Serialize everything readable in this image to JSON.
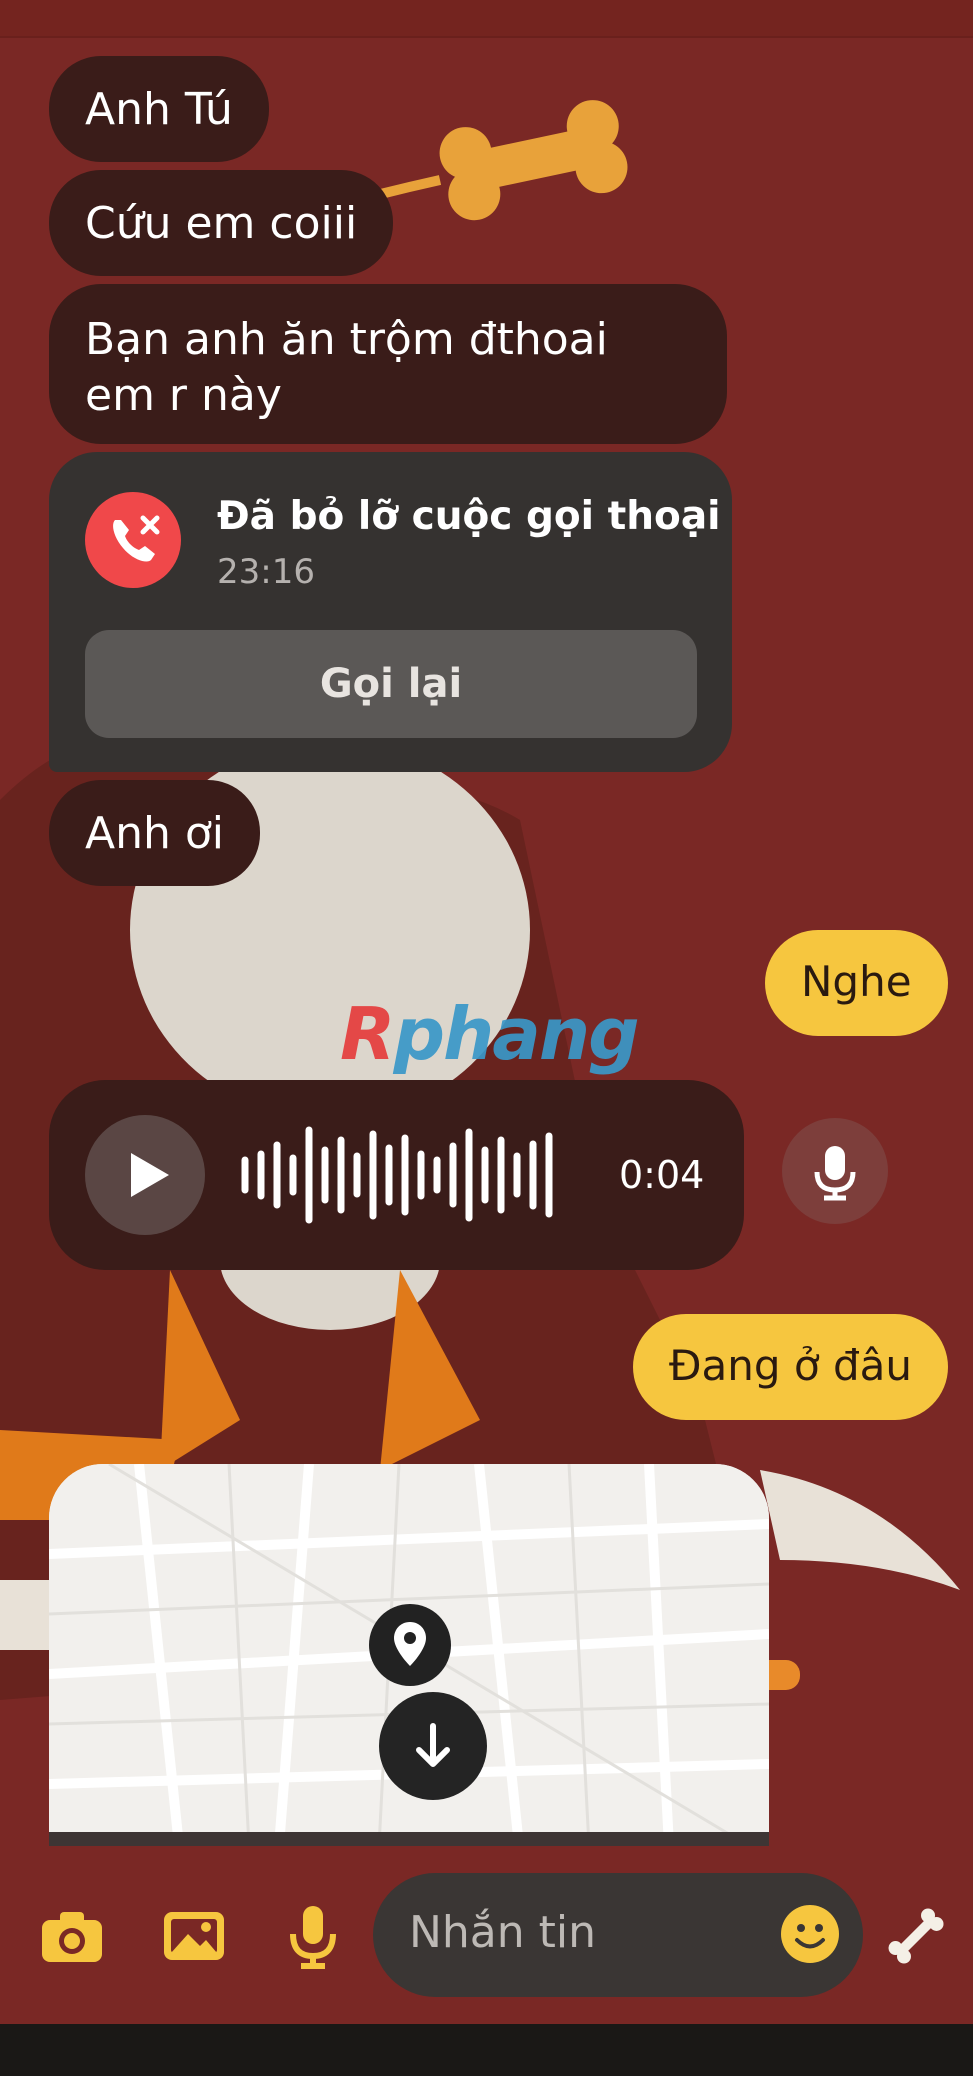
{
  "messages": {
    "m1": "Anh Tú",
    "m2": "Cứu em coiii",
    "m3": "Bạn anh ăn trộm đthoai em r này",
    "m5": "Anh ơi",
    "out1": "Nghe",
    "out2": "Đang ở đâu"
  },
  "call": {
    "title": "Đã bỏ lỡ cuộc gọi thoại",
    "time": "23:16",
    "button": "Gọi lại"
  },
  "voice": {
    "duration": "0:04"
  },
  "composer": {
    "placeholder": "Nhắn tin"
  },
  "watermark": {
    "first": "R",
    "rest": "phang"
  },
  "colors": {
    "background": "#7a2825",
    "incoming": "#3a1c19",
    "outgoing": "#f6c63f",
    "accent": "#f6c63f",
    "missed": "#f0484a"
  },
  "icons": [
    "camera-icon",
    "image-icon",
    "microphone-icon",
    "emoji-icon",
    "bone-icon",
    "play-icon",
    "missed-call-icon",
    "location-pin-icon",
    "download-arrow-icon"
  ]
}
